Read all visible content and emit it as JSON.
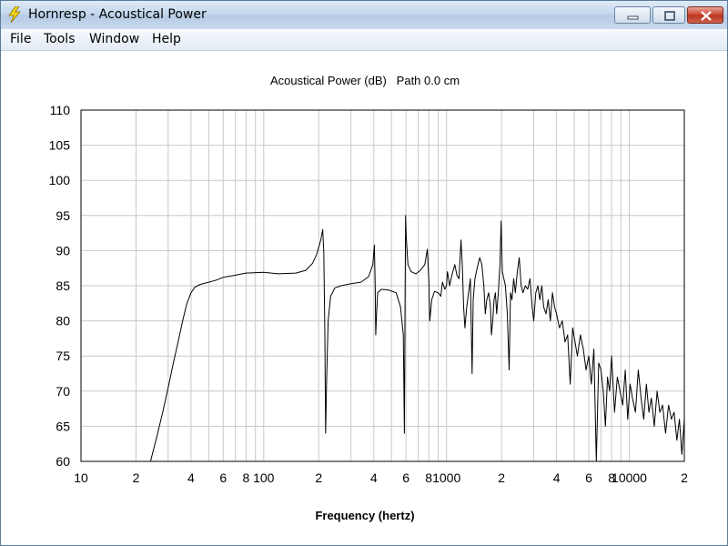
{
  "window": {
    "title": "Hornresp - Acoustical Power",
    "controls": {
      "minimize_icon": "minimize-icon",
      "maximize_icon": "maximize-icon",
      "close_icon": "close-icon"
    },
    "app_icon": "lightning-icon"
  },
  "menu": {
    "items": [
      {
        "label": "File"
      },
      {
        "label": "Tools"
      },
      {
        "label": "Window"
      },
      {
        "label": "Help"
      }
    ]
  },
  "chart_data": {
    "type": "line",
    "title": "Acoustical Power (dB)   Path 0.0 cm",
    "xlabel": "Frequency (hertz)",
    "ylabel": "",
    "xscale": "log",
    "xlim": [
      10,
      20000
    ],
    "ylim": [
      60,
      110
    ],
    "yticks": [
      60,
      65,
      70,
      75,
      80,
      85,
      90,
      95,
      100,
      105,
      110
    ],
    "xtick_labels": [
      {
        "value": 10,
        "label": "10"
      },
      {
        "value": 20,
        "label": "2"
      },
      {
        "value": 40,
        "label": "4"
      },
      {
        "value": 60,
        "label": "6"
      },
      {
        "value": 80,
        "label": "8"
      },
      {
        "value": 100,
        "label": "100"
      },
      {
        "value": 200,
        "label": "2"
      },
      {
        "value": 400,
        "label": "4"
      },
      {
        "value": 600,
        "label": "6"
      },
      {
        "value": 800,
        "label": "8"
      },
      {
        "value": 1000,
        "label": "1000"
      },
      {
        "value": 2000,
        "label": "2"
      },
      {
        "value": 4000,
        "label": "4"
      },
      {
        "value": 6000,
        "label": "6"
      },
      {
        "value": 8000,
        "label": "8"
      },
      {
        "value": 10000,
        "label": "10000"
      },
      {
        "value": 20000,
        "label": "2"
      }
    ],
    "grid": true,
    "line_color": "#000000",
    "grid_color": "#c8c8c8",
    "series": [
      {
        "points": [
          [
            24,
            60
          ],
          [
            26,
            63.5
          ],
          [
            28,
            67
          ],
          [
            30,
            70.5
          ],
          [
            32,
            74
          ],
          [
            34,
            77
          ],
          [
            36,
            80
          ],
          [
            38,
            82.5
          ],
          [
            40,
            84
          ],
          [
            42,
            84.8
          ],
          [
            45,
            85.2
          ],
          [
            50,
            85.5
          ],
          [
            55,
            85.8
          ],
          [
            60,
            86.2
          ],
          [
            70,
            86.5
          ],
          [
            80,
            86.8
          ],
          [
            100,
            86.9
          ],
          [
            120,
            86.7
          ],
          [
            150,
            86.8
          ],
          [
            170,
            87.2
          ],
          [
            185,
            88.2
          ],
          [
            195,
            89.5
          ],
          [
            205,
            91.5
          ],
          [
            210,
            93
          ],
          [
            213,
            90
          ],
          [
            216,
            78
          ],
          [
            218,
            64
          ],
          [
            221,
            72
          ],
          [
            225,
            80
          ],
          [
            232,
            83.5
          ],
          [
            245,
            84.7
          ],
          [
            265,
            85
          ],
          [
            300,
            85.3
          ],
          [
            340,
            85.5
          ],
          [
            375,
            86.3
          ],
          [
            395,
            88
          ],
          [
            403,
            90.8
          ],
          [
            407,
            85
          ],
          [
            410,
            78
          ],
          [
            414,
            81
          ],
          [
            420,
            84
          ],
          [
            440,
            84.5
          ],
          [
            480,
            84.4
          ],
          [
            530,
            84
          ],
          [
            560,
            82
          ],
          [
            580,
            78
          ],
          [
            588,
            64
          ],
          [
            592,
            80
          ],
          [
            597,
            95
          ],
          [
            602,
            92
          ],
          [
            615,
            88
          ],
          [
            640,
            87
          ],
          [
            680,
            86.7
          ],
          [
            720,
            87.2
          ],
          [
            760,
            88
          ],
          [
            785,
            90.2
          ],
          [
            800,
            86
          ],
          [
            810,
            80
          ],
          [
            830,
            83
          ],
          [
            860,
            84.2
          ],
          [
            900,
            84
          ],
          [
            930,
            83.5
          ],
          [
            950,
            85.5
          ],
          [
            980,
            84.5
          ],
          [
            1000,
            85
          ],
          [
            1010,
            87
          ],
          [
            1020,
            86.5
          ],
          [
            1040,
            85
          ],
          [
            1070,
            86.5
          ],
          [
            1110,
            88
          ],
          [
            1140,
            86.5
          ],
          [
            1170,
            86
          ],
          [
            1200,
            91.5
          ],
          [
            1220,
            88
          ],
          [
            1240,
            82
          ],
          [
            1260,
            79
          ],
          [
            1290,
            82
          ],
          [
            1320,
            84
          ],
          [
            1350,
            86
          ],
          [
            1380,
            72.5
          ],
          [
            1400,
            83
          ],
          [
            1430,
            86
          ],
          [
            1470,
            87.5
          ],
          [
            1520,
            89
          ],
          [
            1560,
            88
          ],
          [
            1600,
            85
          ],
          [
            1630,
            81
          ],
          [
            1660,
            83
          ],
          [
            1700,
            84
          ],
          [
            1740,
            82
          ],
          [
            1760,
            78
          ],
          [
            1790,
            80
          ],
          [
            1820,
            83
          ],
          [
            1850,
            84
          ],
          [
            1880,
            81
          ],
          [
            1920,
            84
          ],
          [
            1960,
            88
          ],
          [
            1990,
            94.2
          ],
          [
            2020,
            87
          ],
          [
            2060,
            86
          ],
          [
            2100,
            85
          ],
          [
            2150,
            81
          ],
          [
            2200,
            73
          ],
          [
            2240,
            84
          ],
          [
            2280,
            83
          ],
          [
            2330,
            86
          ],
          [
            2380,
            84
          ],
          [
            2440,
            87
          ],
          [
            2500,
            89
          ],
          [
            2560,
            85
          ],
          [
            2620,
            84
          ],
          [
            2700,
            85
          ],
          [
            2780,
            84.5
          ],
          [
            2860,
            86
          ],
          [
            2940,
            82
          ],
          [
            3000,
            80
          ],
          [
            3080,
            84
          ],
          [
            3160,
            85
          ],
          [
            3240,
            83
          ],
          [
            3320,
            85
          ],
          [
            3400,
            82
          ],
          [
            3500,
            81
          ],
          [
            3600,
            83
          ],
          [
            3700,
            80
          ],
          [
            3800,
            84
          ],
          [
            3900,
            82
          ],
          [
            4000,
            81
          ],
          [
            4150,
            79
          ],
          [
            4300,
            80
          ],
          [
            4450,
            77
          ],
          [
            4600,
            78
          ],
          [
            4750,
            71
          ],
          [
            4900,
            79
          ],
          [
            5050,
            77
          ],
          [
            5200,
            75
          ],
          [
            5400,
            78
          ],
          [
            5600,
            76
          ],
          [
            5800,
            73
          ],
          [
            6000,
            75
          ],
          [
            6200,
            71
          ],
          [
            6400,
            76
          ],
          [
            6600,
            60
          ],
          [
            6800,
            74
          ],
          [
            7000,
            73
          ],
          [
            7200,
            70
          ],
          [
            7400,
            65
          ],
          [
            7600,
            72
          ],
          [
            7800,
            70
          ],
          [
            8000,
            75
          ],
          [
            8300,
            67
          ],
          [
            8600,
            72
          ],
          [
            8900,
            70
          ],
          [
            9200,
            68
          ],
          [
            9500,
            73
          ],
          [
            9800,
            66
          ],
          [
            10100,
            71
          ],
          [
            10400,
            69
          ],
          [
            10800,
            67
          ],
          [
            11200,
            73
          ],
          [
            11600,
            69
          ],
          [
            12000,
            66
          ],
          [
            12400,
            71
          ],
          [
            12800,
            67
          ],
          [
            13200,
            69
          ],
          [
            13700,
            65
          ],
          [
            14200,
            70
          ],
          [
            14700,
            67
          ],
          [
            15200,
            68
          ],
          [
            15800,
            64
          ],
          [
            16400,
            68
          ],
          [
            17000,
            66
          ],
          [
            17600,
            67
          ],
          [
            18200,
            63
          ],
          [
            18800,
            66
          ],
          [
            19400,
            61
          ],
          [
            20000,
            66
          ]
        ]
      }
    ]
  }
}
